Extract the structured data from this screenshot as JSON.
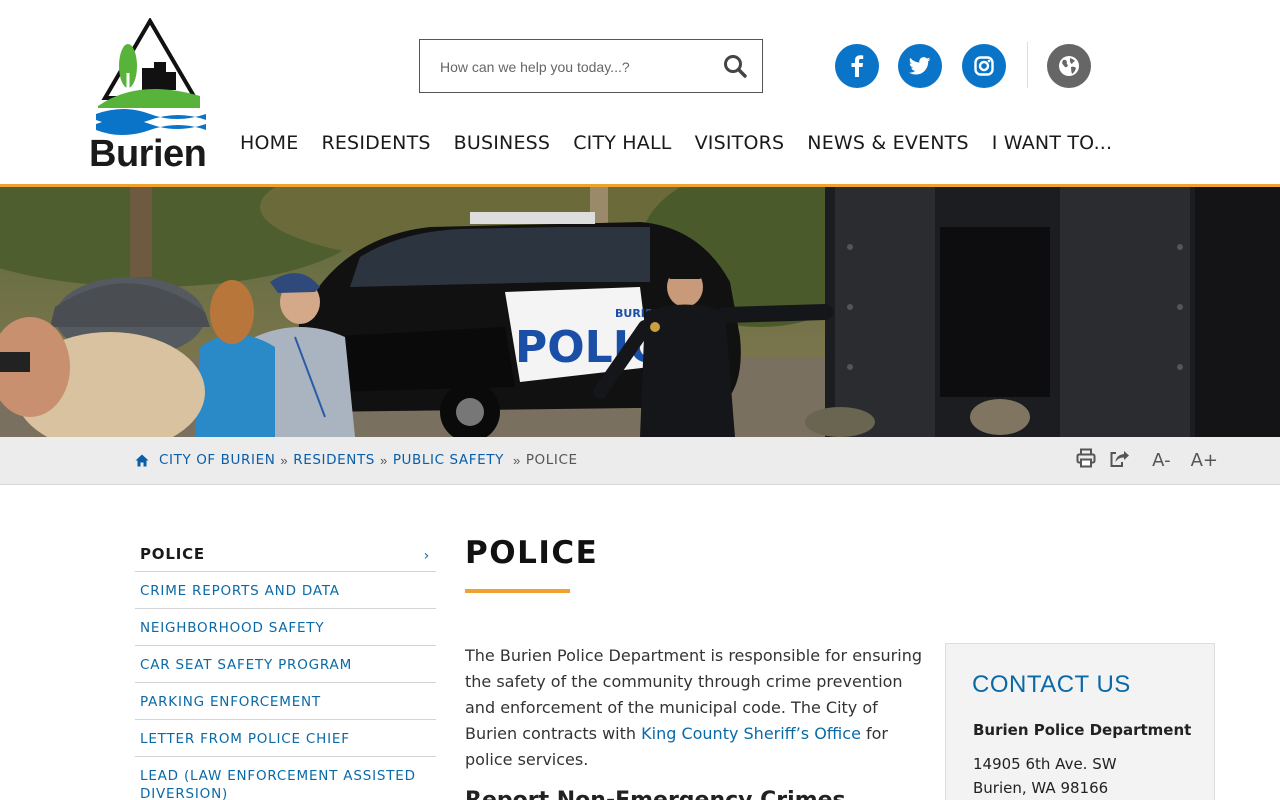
{
  "brand": {
    "logo_text": "Burien",
    "colors": {
      "blue": "#0a74c8",
      "green": "#58b33a",
      "orange": "#f0a22e",
      "link": "#0a6aa8"
    }
  },
  "search": {
    "placeholder": "How can we help you today...?",
    "icon": "search-icon"
  },
  "social": [
    {
      "name": "facebook",
      "icon": "facebook-icon"
    },
    {
      "name": "twitter",
      "icon": "twitter-icon"
    },
    {
      "name": "instagram",
      "icon": "instagram-icon"
    },
    {
      "name": "translate",
      "icon": "globe-icon"
    }
  ],
  "nav": [
    "HOME",
    "RESIDENTS",
    "BUSINESS",
    "CITY HALL",
    "VISITORS",
    "NEWS & EVENTS",
    "I WANT TO..."
  ],
  "breadcrumb": {
    "items": [
      "CITY OF BURIEN",
      "RESIDENTS",
      "PUBLIC SAFETY"
    ],
    "current": "POLICE",
    "separator": "»"
  },
  "tools": {
    "print_icon": "print-icon",
    "share_icon": "share-icon",
    "text_smaller": "A-",
    "text_larger": "A+"
  },
  "sidebar": {
    "heading": "POLICE",
    "chevron": "›",
    "items": [
      "CRIME REPORTS AND DATA",
      "NEIGHBORHOOD SAFETY",
      "CAR SEAT SAFETY PROGRAM",
      "PARKING ENFORCEMENT",
      "LETTER FROM POLICE CHIEF",
      "LEAD (LAW ENFORCEMENT ASSISTED DIVERSION)"
    ]
  },
  "main": {
    "title": "POLICE",
    "intro_before": "The Burien Police Department is responsible for ensuring the safety of the community through crime prevention and enforcement of the municipal code. The City of Burien contracts with ",
    "intro_link": "King County Sheriff’s Office",
    "intro_after": " for police services.",
    "subhead": "Report Non-Emergency Crimes Online"
  },
  "contact": {
    "heading": "CONTACT US",
    "dept": "Burien Police Department",
    "address_line1": "14905 6th Ave. SW",
    "address_line2": "Burien, WA 98166"
  },
  "hero": {
    "vehicle_text": "POLICE",
    "vehicle_brand": "BURIEN"
  }
}
